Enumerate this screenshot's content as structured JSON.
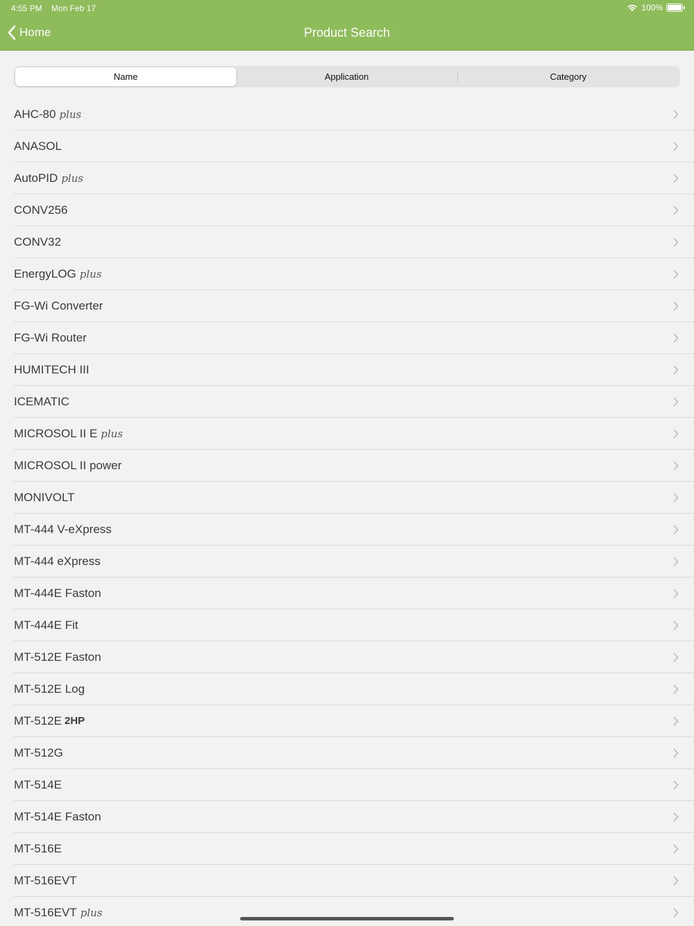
{
  "status": {
    "time": "4:55 PM",
    "date": "Mon Feb 17",
    "battery": "100%",
    "battery_level": 1.0
  },
  "nav": {
    "back_label": "Home",
    "title": "Product Search"
  },
  "segments": [
    {
      "label": "Name",
      "active": true
    },
    {
      "label": "Application",
      "active": false
    },
    {
      "label": "Category",
      "active": false
    }
  ],
  "items": [
    {
      "name": "AHC-80",
      "suffix": "plus",
      "suffix_style": "script"
    },
    {
      "name": "ANASOL"
    },
    {
      "name": "AutoPID",
      "suffix": "plus",
      "suffix_style": "script"
    },
    {
      "name": "CONV256"
    },
    {
      "name": "CONV32"
    },
    {
      "name": "EnergyLOG",
      "suffix": "plus",
      "suffix_style": "script"
    },
    {
      "name": "FG-Wi Converter"
    },
    {
      "name": "FG-Wi Router"
    },
    {
      "name": "HUMITECH III"
    },
    {
      "name": "ICEMATIC"
    },
    {
      "name": "MICROSOL II E",
      "suffix": "plus",
      "suffix_style": "script"
    },
    {
      "name": "MICROSOL II power"
    },
    {
      "name": "MONIVOLT"
    },
    {
      "name": "MT-444 V-eXpress"
    },
    {
      "name": "MT-444 eXpress"
    },
    {
      "name": "MT-444E Faston"
    },
    {
      "name": "MT-444E Fit"
    },
    {
      "name": "MT-512E Faston"
    },
    {
      "name": "MT-512E Log"
    },
    {
      "name": "MT-512E",
      "suffix": "2HP",
      "suffix_style": "bold"
    },
    {
      "name": "MT-512G"
    },
    {
      "name": "MT-514E"
    },
    {
      "name": "MT-514E Faston"
    },
    {
      "name": "MT-516E"
    },
    {
      "name": "MT-516EVT"
    },
    {
      "name": "MT-516EVT",
      "suffix": "plus",
      "suffix_style": "script"
    }
  ],
  "icons": {
    "back": "chevron-left-icon",
    "row": "chevron-right-icon",
    "wifi": "wifi-icon",
    "battery": "battery-icon"
  },
  "colors": {
    "nav_background": "#8fbc5a",
    "list_background": "#f2f2f2",
    "separator": "#d8d8d8"
  }
}
